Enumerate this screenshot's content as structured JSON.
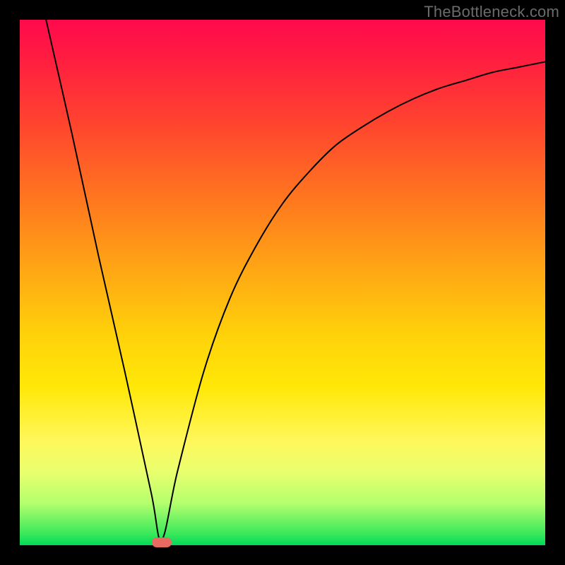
{
  "watermark": "TheBottleneck.com",
  "chart_data": {
    "type": "line",
    "title": "",
    "xlabel": "",
    "ylabel": "",
    "xlim": [
      0,
      100
    ],
    "ylim": [
      0,
      100
    ],
    "grid": false,
    "legend": false,
    "annotations": [
      {
        "kind": "marker",
        "x": 27,
        "y": 0.5,
        "color": "#e86a60"
      }
    ],
    "series": [
      {
        "name": "left-branch",
        "x": [
          5,
          10,
          15,
          20,
          25,
          27
        ],
        "values": [
          100,
          78,
          55,
          33,
          10,
          1
        ]
      },
      {
        "name": "right-branch",
        "x": [
          27,
          30,
          35,
          40,
          45,
          50,
          55,
          60,
          65,
          70,
          75,
          80,
          85,
          90,
          95,
          100
        ],
        "values": [
          1,
          14,
          33,
          47,
          57,
          65,
          71,
          76,
          79.5,
          82.5,
          85,
          87,
          88.5,
          90,
          91,
          92
        ]
      }
    ]
  }
}
